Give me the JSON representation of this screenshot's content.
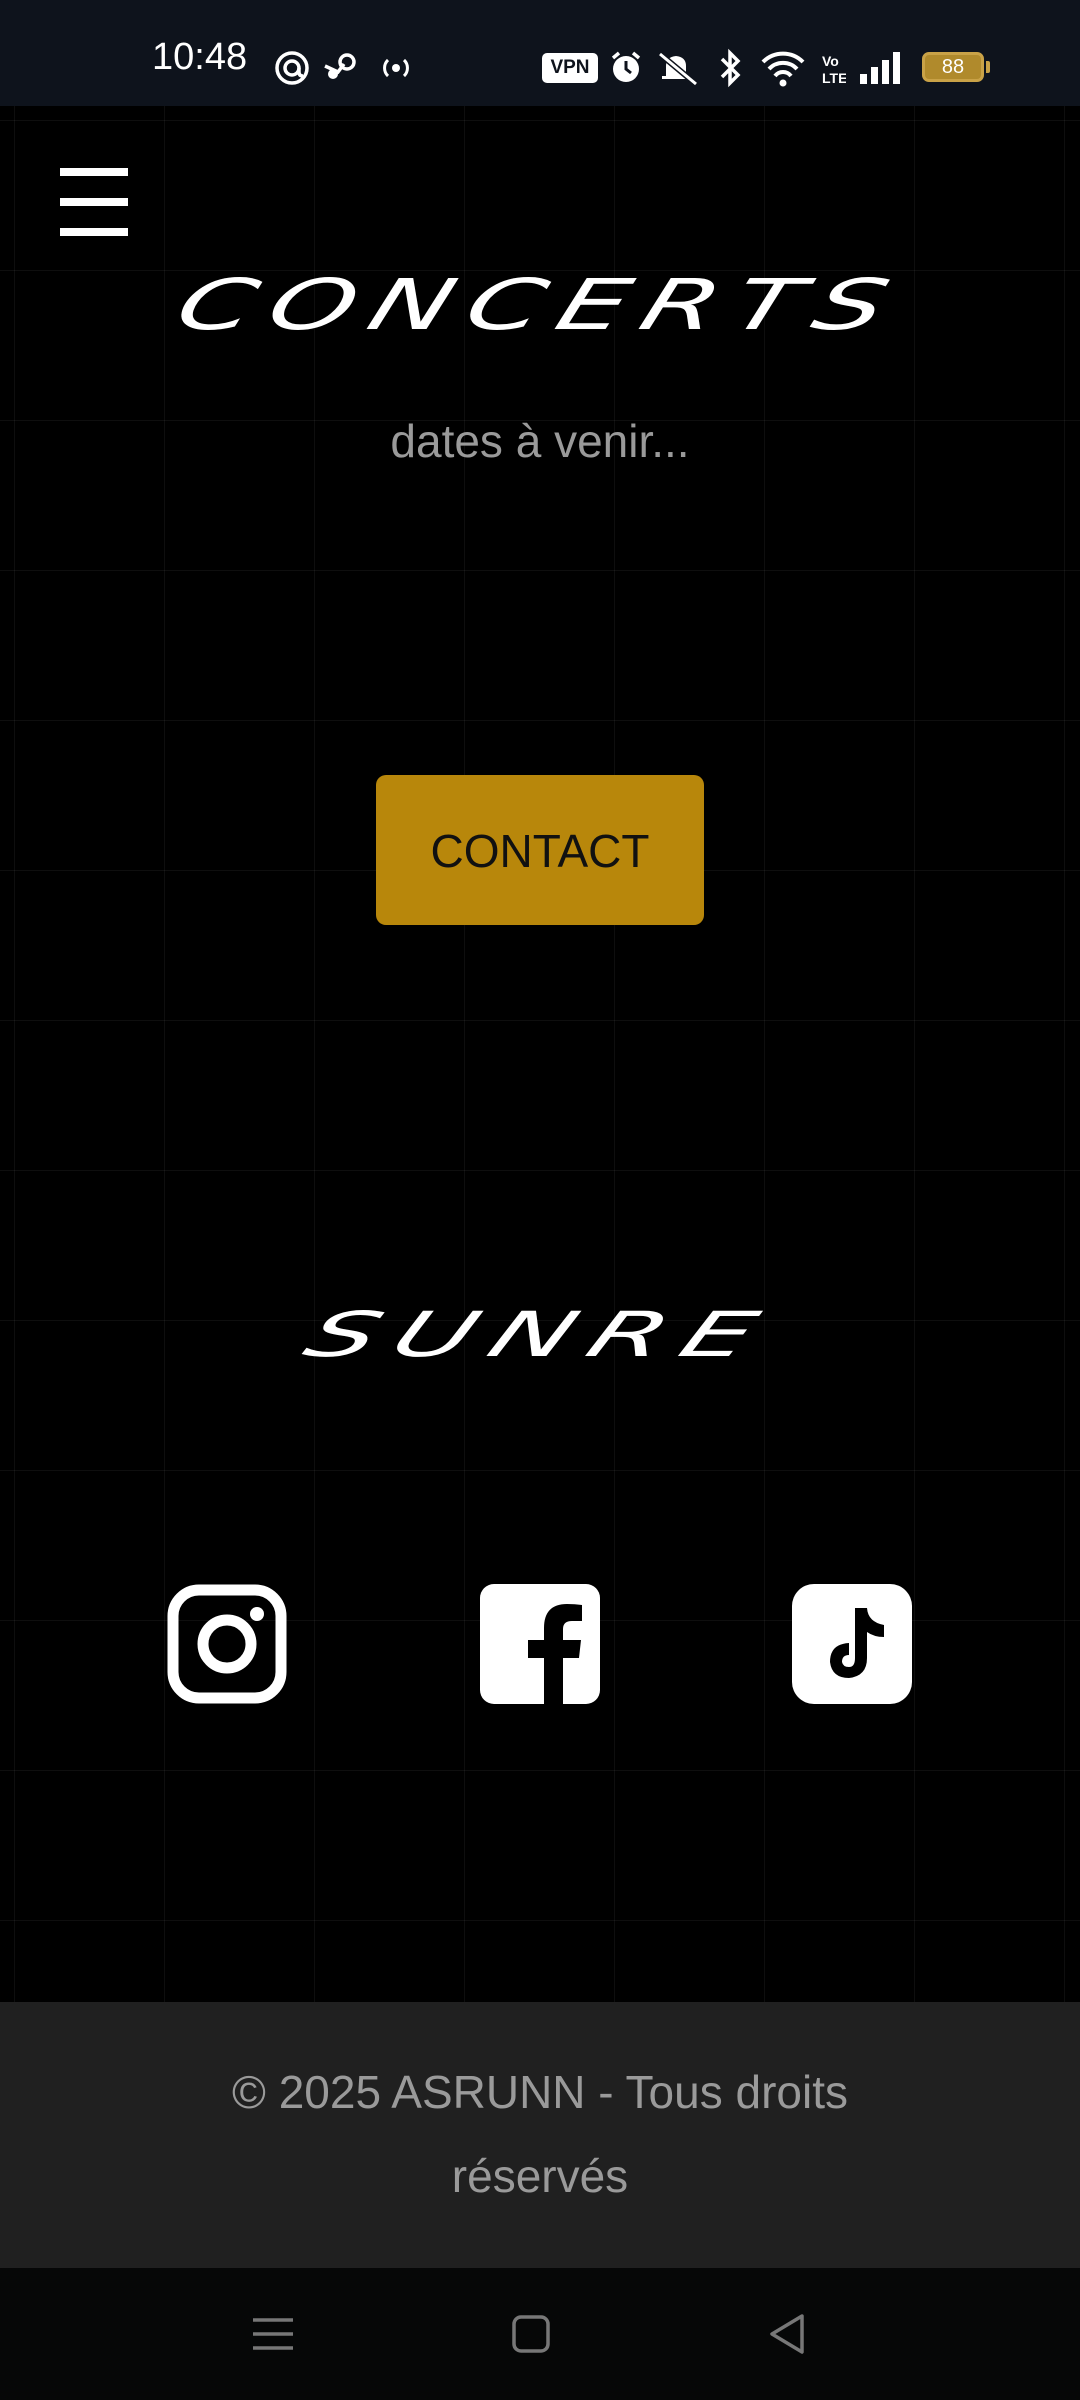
{
  "status_bar": {
    "time": "10:48",
    "vpn_label": "VPN",
    "battery_level": "88",
    "icons": [
      "at-sign-icon",
      "steam-icon",
      "hotspot-icon",
      "vpn-icon",
      "alarm-icon",
      "mute-icon",
      "bluetooth-icon",
      "wifi-icon",
      "volte-icon",
      "signal-icon",
      "battery-icon"
    ]
  },
  "header": {
    "menu_icon": "hamburger-menu-icon"
  },
  "main": {
    "title": "CONCERTS",
    "subtitle": "dates à venir...",
    "contact_button": "CONTACT",
    "logo_text": "SUNRE",
    "social": [
      {
        "name": "instagram-icon"
      },
      {
        "name": "facebook-icon"
      },
      {
        "name": "tiktok-icon"
      }
    ]
  },
  "footer": {
    "copyright": "© 2025 ASRUNN - Tous droits réservés"
  },
  "nav_bar": {
    "buttons": [
      "recent-apps-icon",
      "home-icon",
      "back-icon"
    ]
  },
  "colors": {
    "accent": "#b8870b",
    "background": "#000000",
    "footer_bg": "#202020",
    "muted_text": "#9a9a9a"
  }
}
